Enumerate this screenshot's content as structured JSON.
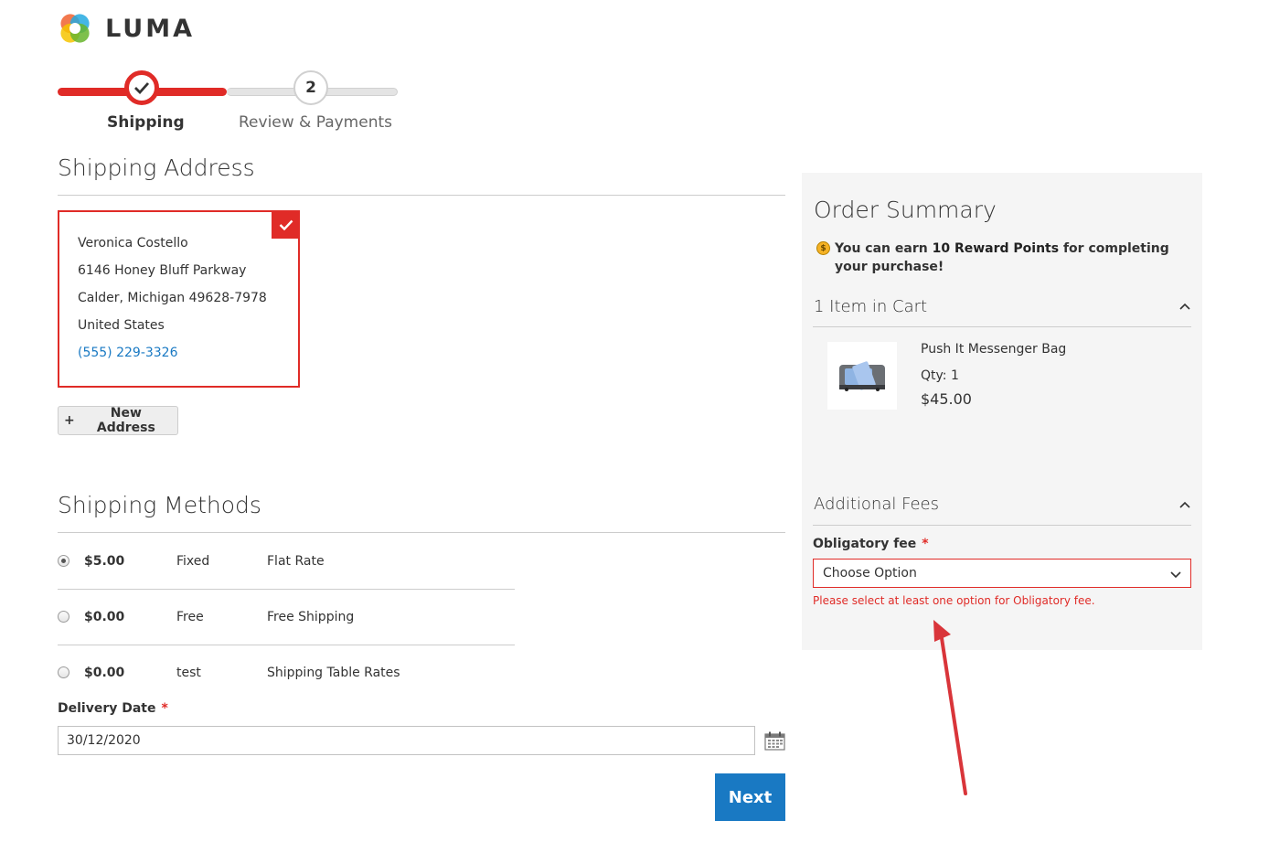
{
  "brand": {
    "name": "LUMA"
  },
  "progress": {
    "steps": [
      {
        "label": "Shipping",
        "state": "complete"
      },
      {
        "number": "2",
        "label": "Review & Payments",
        "state": "pending"
      }
    ]
  },
  "shipping_address": {
    "title": "Shipping Address",
    "selected": {
      "name": "Veronica Costello",
      "street": "6146 Honey Bluff Parkway",
      "city_line": "Calder, Michigan 49628-7978",
      "country": "United States",
      "phone": "(555) 229-3326"
    },
    "new_address_label": "New Address",
    "new_address_icon": "+"
  },
  "shipping_methods": {
    "title": "Shipping Methods",
    "rows": [
      {
        "price": "$5.00",
        "method": "Fixed",
        "carrier": "Flat Rate",
        "selected": true
      },
      {
        "price": "$0.00",
        "method": "Free",
        "carrier": "Free Shipping",
        "selected": false
      },
      {
        "price": "$0.00",
        "method": "test",
        "carrier": "Shipping Table Rates",
        "selected": false
      }
    ]
  },
  "delivery_date": {
    "label": "Delivery Date",
    "required_mark": "*",
    "value": "30/12/2020"
  },
  "next_button": {
    "label": "Next"
  },
  "order_summary": {
    "title": "Order Summary",
    "reward": {
      "prefix": "You can earn ",
      "points": "10 Reward Points",
      "suffix": " for completing your purchase!"
    },
    "cart": {
      "title": "1 Item in Cart",
      "items": [
        {
          "name": "Push It Messenger Bag",
          "qty": "Qty: 1",
          "price": "$45.00"
        }
      ]
    },
    "additional_fees": {
      "title": "Additional Fees",
      "field_label": "Obligatory fee",
      "required_mark": "*",
      "select_value": "Choose Option",
      "error": "Please select at least one option for Obligatory fee."
    }
  },
  "colors": {
    "accent_red": "#e02b27",
    "link_blue": "#1979c3",
    "sidebar_bg": "#f5f5f5"
  }
}
